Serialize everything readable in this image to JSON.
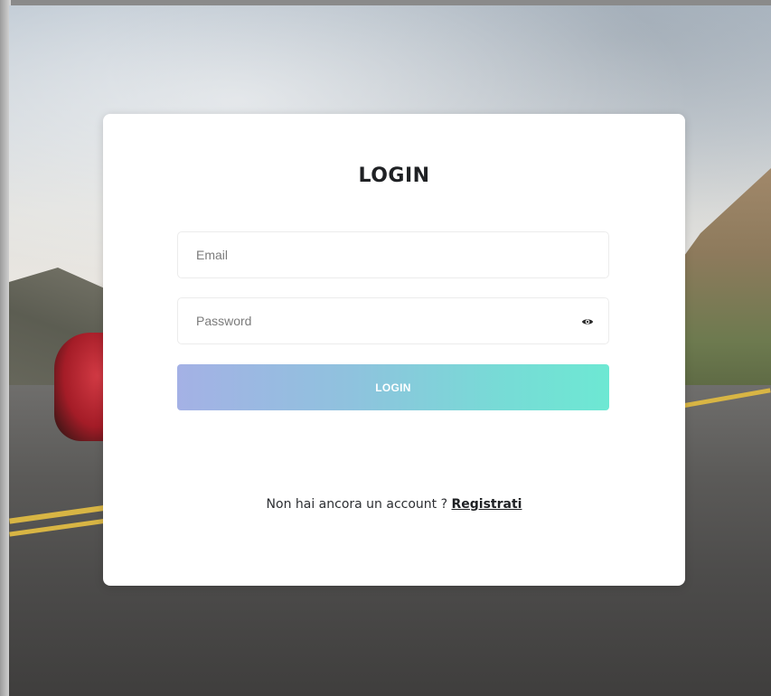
{
  "login": {
    "title": "LOGIN",
    "email_placeholder": "Email",
    "password_placeholder": "Password",
    "submit_label": "LOGIN",
    "signup_prompt": "Non hai ancora un account ?",
    "signup_link": "Registrati"
  },
  "colors": {
    "card_background": "#ffffff",
    "button_gradient_start": "#a4b1e5",
    "button_gradient_end": "#6de8d3",
    "title_text": "#1f2124"
  },
  "icons": {
    "password_toggle": "eye-icon"
  }
}
